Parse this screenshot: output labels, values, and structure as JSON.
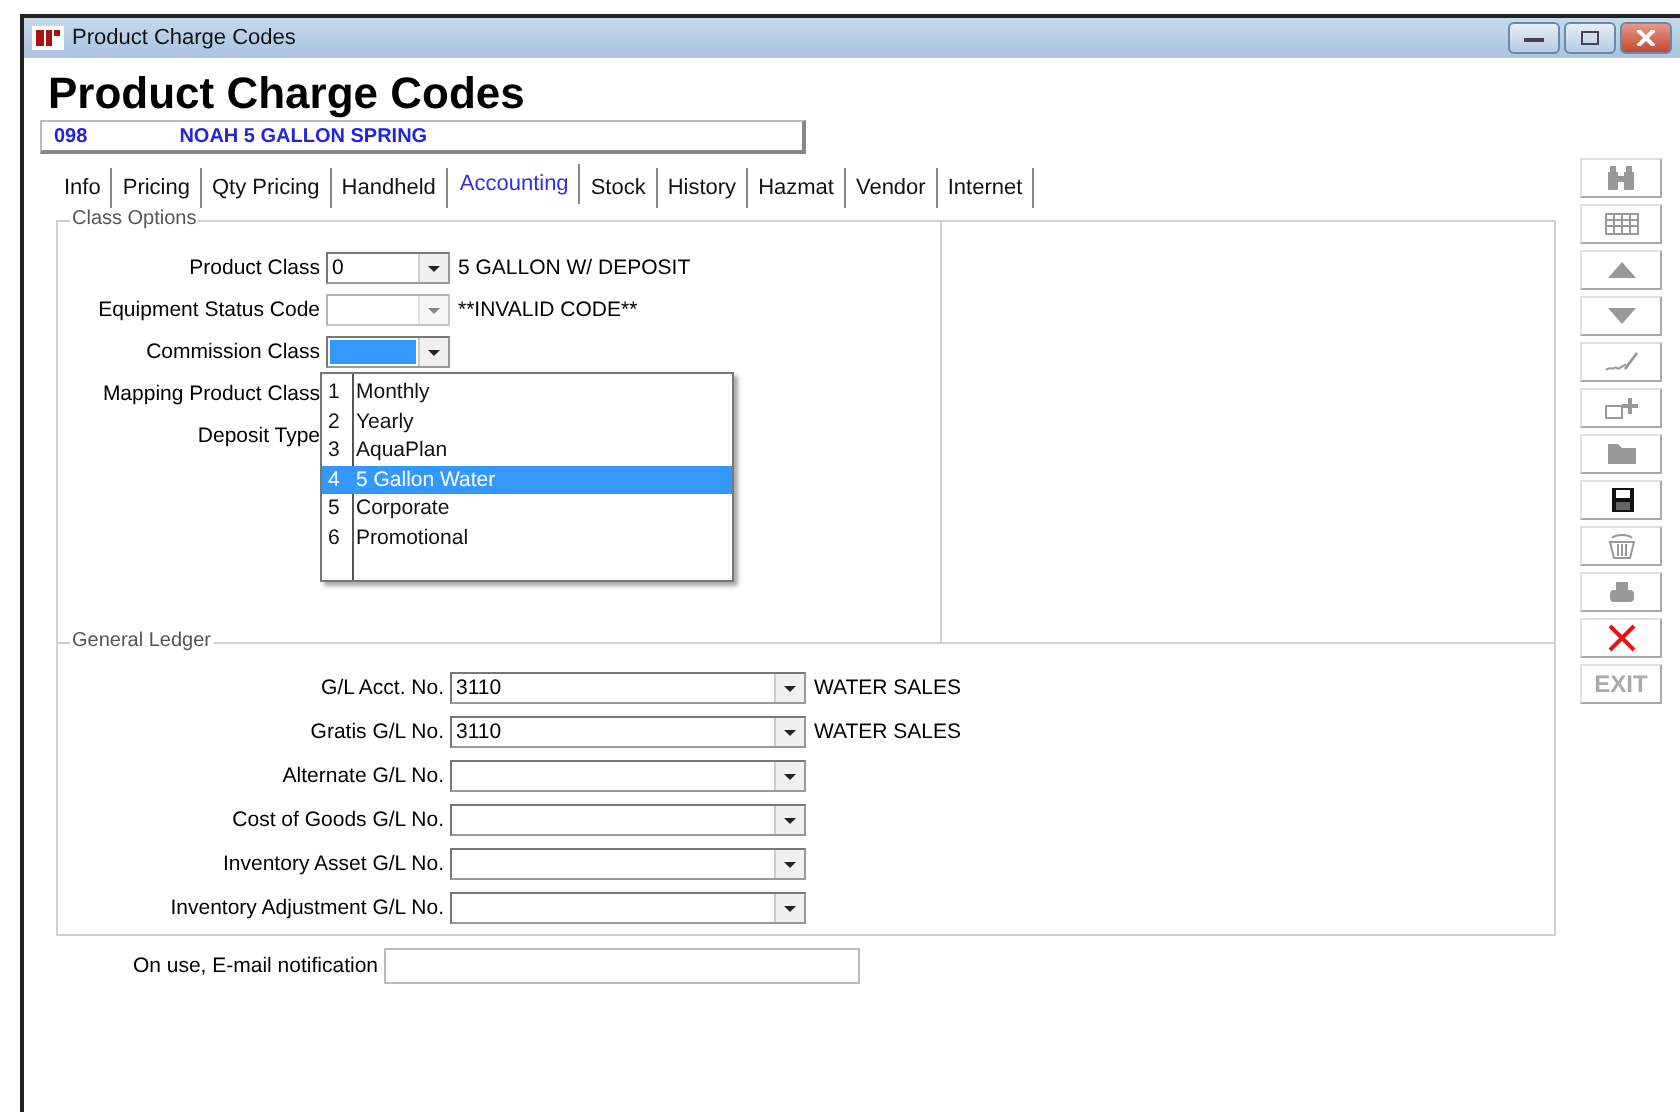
{
  "window": {
    "title": "Product Charge Codes"
  },
  "heading": "Product Charge Codes",
  "record": {
    "code": "098",
    "name": "NOAH 5 GALLON SPRING"
  },
  "tabs": [
    {
      "label": "Info",
      "selected": false
    },
    {
      "label": "Pricing",
      "selected": false
    },
    {
      "label": "Qty Pricing",
      "selected": false
    },
    {
      "label": "Handheld",
      "selected": false
    },
    {
      "label": "Accounting",
      "selected": true
    },
    {
      "label": "Stock",
      "selected": false
    },
    {
      "label": "History",
      "selected": false
    },
    {
      "label": "Hazmat",
      "selected": false
    },
    {
      "label": "Vendor",
      "selected": false
    },
    {
      "label": "Internet",
      "selected": false
    }
  ],
  "class_options": {
    "title": "Class Options",
    "fields": [
      {
        "kind": "combo",
        "label": "Product Class",
        "value": "0",
        "description": "5 GALLON W/ DEPOSIT",
        "disabled": false,
        "focused": false
      },
      {
        "kind": "combo",
        "label": "Equipment Status Code",
        "description": "**INVALID CODE**",
        "disabled": true,
        "focused": false
      },
      {
        "kind": "combo",
        "label": "Commission Class",
        "disabled": false,
        "focused": true
      },
      {
        "kind": "label",
        "label": "Mapping Product Class"
      },
      {
        "kind": "label",
        "label": "Deposit Type"
      }
    ]
  },
  "dropdown": {
    "items": [
      {
        "number": "1",
        "label": "Monthly",
        "selected": false
      },
      {
        "number": "2",
        "label": "Yearly",
        "selected": false
      },
      {
        "number": "3",
        "label": "AquaPlan",
        "selected": false
      },
      {
        "number": "4",
        "label": "5 Gallon Water",
        "selected": true
      },
      {
        "number": "5",
        "label": "Corporate",
        "selected": false
      },
      {
        "number": "6",
        "label": "Promotional",
        "selected": false
      }
    ]
  },
  "general_ledger": {
    "title": "General Ledger",
    "fields": [
      {
        "label": "G/L Acct. No.",
        "value": "3110",
        "description": "WATER SALES"
      },
      {
        "label": "Gratis G/L No.",
        "value": "3110",
        "description": "WATER SALES"
      },
      {
        "label": "Alternate G/L No."
      },
      {
        "label": "Cost of Goods G/L No."
      },
      {
        "label": "Inventory Asset G/L No."
      },
      {
        "label": "Inventory Adjustment G/L No."
      }
    ]
  },
  "email": {
    "label": "On use, E-mail notification"
  },
  "toolbar": [
    {
      "kind": "find",
      "disabled": true
    },
    {
      "kind": "grid",
      "disabled": true
    },
    {
      "kind": "up",
      "disabled": true
    },
    {
      "kind": "down",
      "disabled": true
    },
    {
      "kind": "sign",
      "disabled": true
    },
    {
      "kind": "add",
      "disabled": true
    },
    {
      "kind": "folder",
      "disabled": true
    },
    {
      "kind": "save",
      "disabled": false
    },
    {
      "kind": "basket",
      "disabled": true
    },
    {
      "kind": "print",
      "disabled": true
    },
    {
      "kind": "delete",
      "disabled": false
    },
    {
      "kind": "exit",
      "label": "EXIT",
      "disabled": true
    }
  ]
}
